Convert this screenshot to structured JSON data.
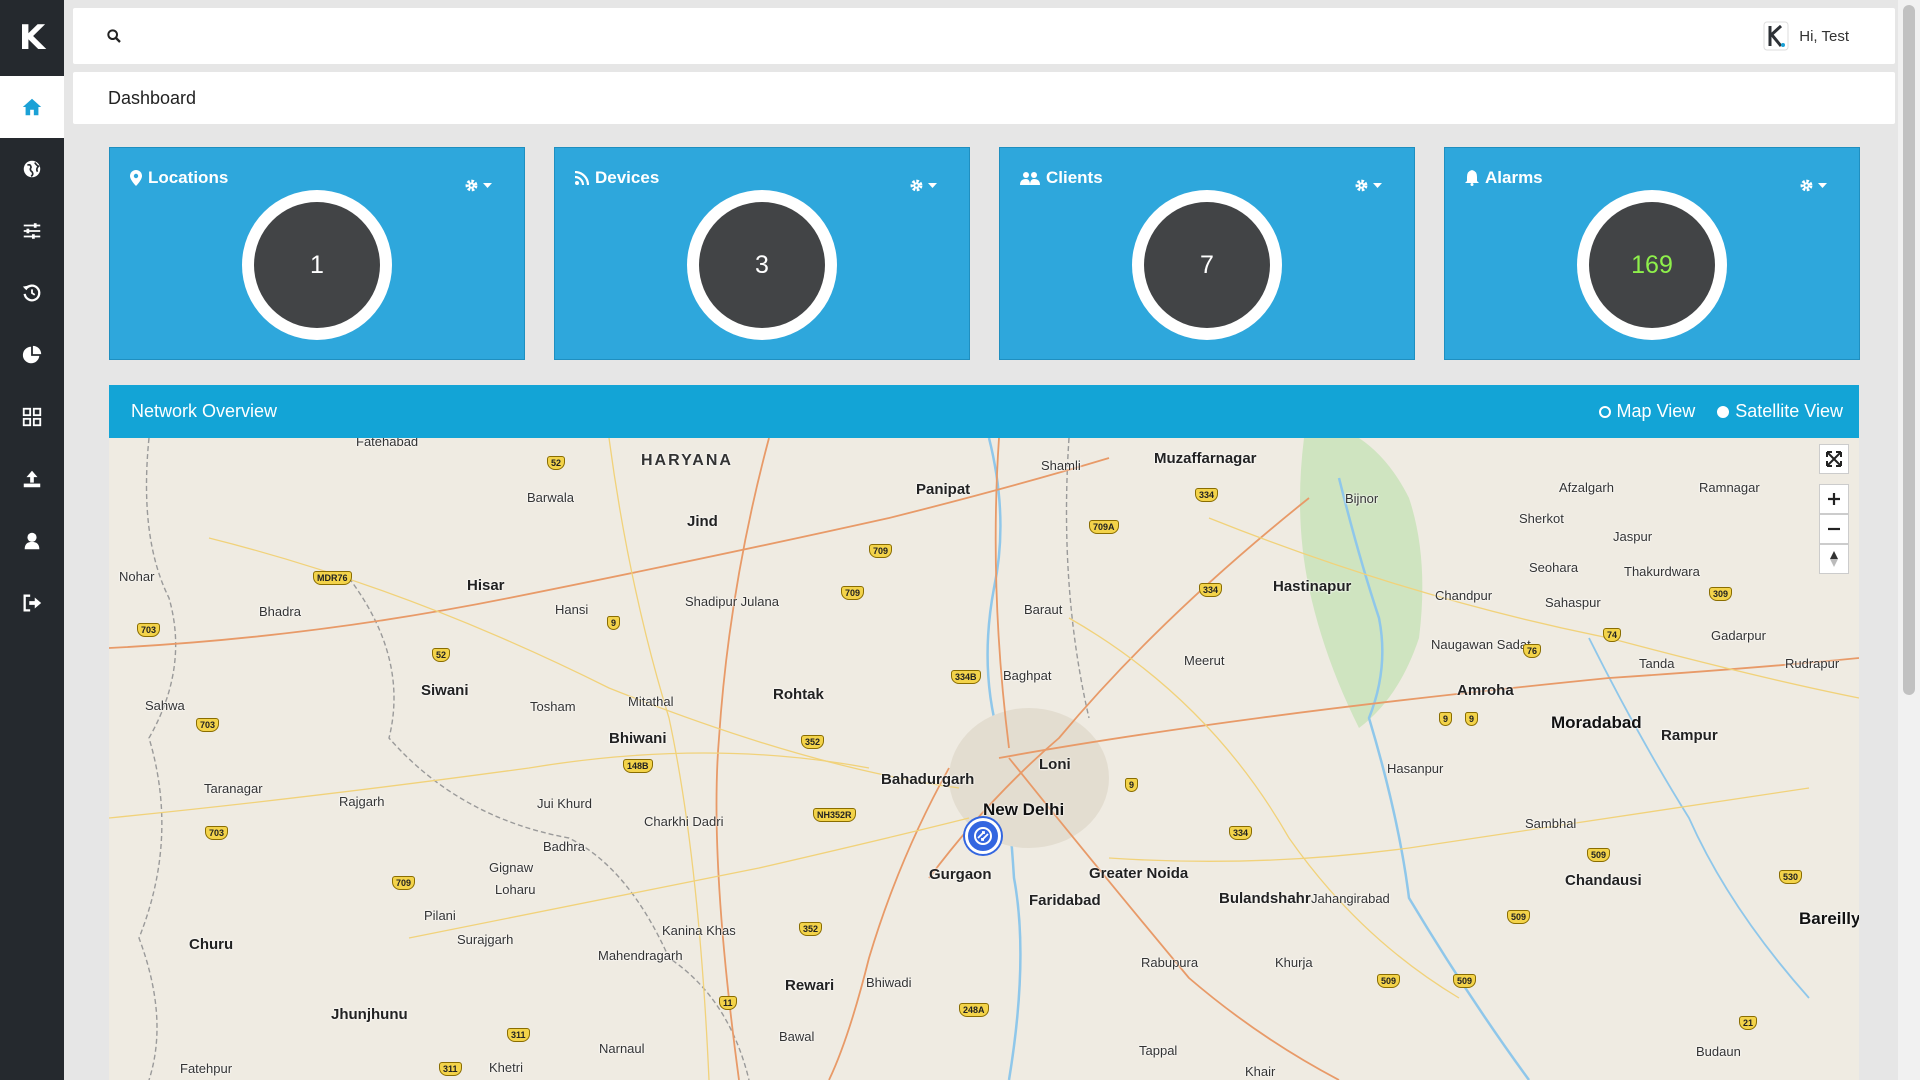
{
  "app": {
    "brand_letter": "K"
  },
  "sidebar": {
    "items": [
      {
        "icon": "home-icon",
        "active": true
      },
      {
        "icon": "globe-icon"
      },
      {
        "icon": "sliders-icon"
      },
      {
        "icon": "history-icon"
      },
      {
        "icon": "pie-chart-icon"
      },
      {
        "icon": "grid-icon"
      },
      {
        "icon": "upload-icon"
      },
      {
        "icon": "user-icon"
      },
      {
        "icon": "sign-out-icon"
      }
    ]
  },
  "topbar": {
    "user_greeting": "Hi, Test",
    "search_icon": "search-icon"
  },
  "page": {
    "title": "Dashboard"
  },
  "cards": [
    {
      "title": "Locations",
      "value": "1",
      "icon": "map-marker-icon"
    },
    {
      "title": "Devices",
      "value": "3",
      "icon": "rss-icon"
    },
    {
      "title": "Clients",
      "value": "7",
      "icon": "users-icon"
    },
    {
      "title": "Alarms",
      "value": "169",
      "icon": "bell-icon",
      "value_color": "#8ef04b"
    }
  ],
  "network": {
    "title": "Network Overview",
    "view_options": [
      {
        "label": "Map View",
        "selected": false
      },
      {
        "label": "Satellite View",
        "selected": true
      }
    ],
    "map_labels": {
      "region": "HARYANA",
      "cities": [
        "Fatehabad",
        "Panipat",
        "Shamli",
        "Muzaffarnagar",
        "Bijnor",
        "Afzalgarh",
        "Ramnagar",
        "Barwala",
        "Jind",
        "Sherkot",
        "Jaspur",
        "Nohar",
        "Hisar",
        "Hansi",
        "Shadipur Julana",
        "Baraut",
        "Hastinapur",
        "Chandpur",
        "Seohara",
        "Thakurdwara",
        "Sahaspur",
        "Bhadra",
        "Naugawan Sadat",
        "Gadarpur",
        "Rudrapur",
        "Tanda",
        "Meerut",
        "Baghpat",
        "Amroha",
        "Siwani",
        "Tosham",
        "Mitathal",
        "Rohtak",
        "Moradabad",
        "Rampur",
        "Sahwa",
        "Bhiwani",
        "Loni",
        "Hasanpur",
        "Taranagar",
        "Rajgarh",
        "Bahadurgarh",
        "Jui Khurd",
        "Charkhi Dadri",
        "New Delhi",
        "Sambhal",
        "Gurgaon",
        "Greater Noida",
        "Badhra",
        "Gignaw",
        "Loharu",
        "Faridabad",
        "Bulandshahr",
        "Jahangirabad",
        "Chandausi",
        "Pilani",
        "Surajgarh",
        "Kanina Khas",
        "Rabupura",
        "Khurja",
        "Bareilly",
        "Churu",
        "Mahendragarh",
        "Rewari",
        "Bhiwadi",
        "Jhunjhunu",
        "Bawal",
        "Narnaul",
        "Tappal",
        "Budaun",
        "Fatehpur",
        "Khetri",
        "Khair"
      ],
      "highways": [
        "52",
        "709",
        "334",
        "709A",
        "MDR76",
        "9",
        "703",
        "52",
        "709",
        "334B",
        "334",
        "74",
        "309",
        "76",
        "9",
        "9",
        "352",
        "148B",
        "NH352R",
        "9",
        "334",
        "703",
        "703",
        "709",
        "352",
        "509",
        "530",
        "509",
        "509",
        "509",
        "11",
        "248A",
        "21",
        "311",
        "311"
      ]
    },
    "map_controls": [
      "fullscreen-icon",
      "zoom-in-icon",
      "zoom-out-icon",
      "compass-icon"
    ]
  }
}
